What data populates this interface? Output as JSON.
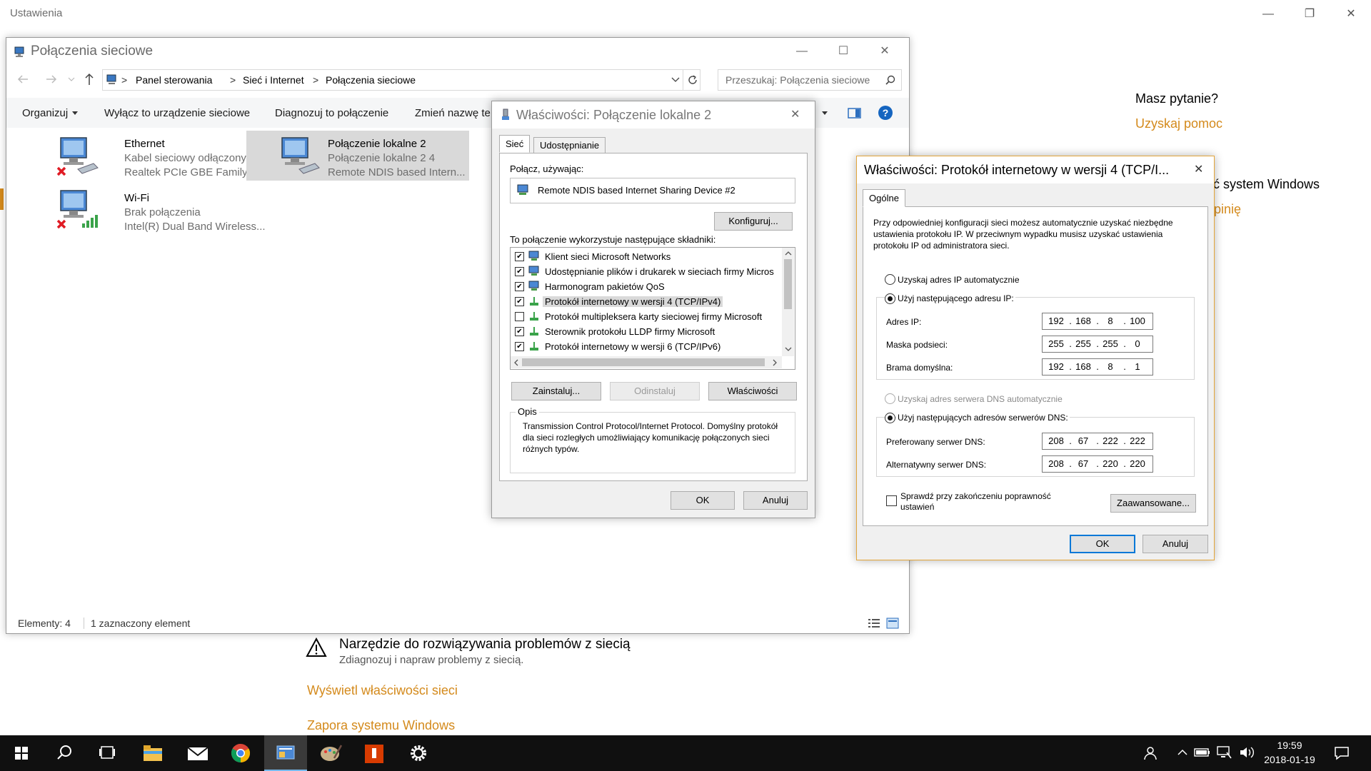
{
  "settings": {
    "title": "Ustawienia",
    "help_question": "Masz pytanie?",
    "help_link": "Uzyskaj pomoc",
    "improve_text": "yć system Windows",
    "feedback_link": "opinię",
    "troubleshoot_title": "Narzędzie do rozwiązywania problemów z siecią",
    "troubleshoot_sub": "Zdiagnozuj i napraw problemy z siecią.",
    "view_props_link": "Wyświetl właściwości sieci",
    "firewall_link": "Zapora systemu Windows",
    "window_controls": {
      "minimize": "—",
      "maximize": "❐",
      "close": "✕"
    }
  },
  "net_window": {
    "title": "Połączenia sieciowe",
    "controls": {
      "minimize": "—",
      "maximize": "☐",
      "close": "✕"
    },
    "breadcrumb": [
      "Panel sterowania",
      "Sieć i Internet",
      "Połączenia sieciowe"
    ],
    "breadcrumb_sep": ">",
    "search_placeholder": "Przeszukaj: Połączenia sieciowe",
    "toolbar": {
      "organize": "Organizuj",
      "disable": "Wyłącz to urządzenie sieciowe",
      "diagnose": "Diagnozuj to połączenie",
      "rename": "Zmień nazwę te"
    },
    "connections": [
      {
        "name": "Ethernet",
        "status": "Kabel sieciowy odłączony",
        "device": "Realtek PCIe GBE Family Co..."
      },
      {
        "name": "Połączenie lokalne 2",
        "status": "Połączenie lokalne 2  4",
        "device": "Remote NDIS based Intern..."
      },
      {
        "name": "Wi-Fi",
        "status": "Brak połączenia",
        "device": "Intel(R) Dual Band Wireless..."
      }
    ],
    "status": {
      "count": "Elementy: 4",
      "selected": "1 zaznaczony element"
    }
  },
  "local_props": {
    "title": "Właściwości: Połączenie lokalne 2",
    "close": "✕",
    "tabs": [
      "Sieć",
      "Udostępnianie"
    ],
    "connect_using_label": "Połącz, używając:",
    "device": "Remote NDIS based Internet Sharing Device #2",
    "configure_btn": "Konfiguruj...",
    "components_label": "To połączenie wykorzystuje następujące składniki:",
    "components": [
      {
        "label": "Klient sieci Microsoft Networks",
        "checked": true
      },
      {
        "label": "Udostępnianie plików i drukarek w sieciach firmy Micros",
        "checked": true
      },
      {
        "label": "Harmonogram pakietów QoS",
        "checked": true
      },
      {
        "label": "Protokół internetowy w wersji 4 (TCP/IPv4)",
        "checked": true
      },
      {
        "label": "Protokół multipleksera karty sieciowej firmy Microsoft",
        "checked": false
      },
      {
        "label": "Sterownik protokołu LLDP firmy Microsoft",
        "checked": true
      },
      {
        "label": "Protokół internetowy w wersji 6 (TCP/IPv6)",
        "checked": true
      }
    ],
    "install_btn": "Zainstaluj...",
    "uninstall_btn": "Odinstaluj",
    "properties_btn": "Właściwości",
    "description_title": "Opis",
    "description": "Transmission Control Protocol/Internet Protocol. Domyślny protokół dla sieci rozległych umożliwiający komunikację połączonych sieci różnych typów.",
    "ok_btn": "OK",
    "cancel_btn": "Anuluj",
    "check_mark": "✔"
  },
  "ipv4": {
    "title": "Właściwości: Protokół internetowy w wersji 4 (TCP/I...",
    "close": "✕",
    "tab": "Ogólne",
    "intro": "Przy odpowiedniej konfiguracji sieci możesz automatycznie uzyskać niezbędne ustawienia protokołu IP. W przeciwnym wypadku musisz uzyskać ustawienia protokołu IP od administratora sieci.",
    "auto_ip": "Uzyskaj adres IP automatycznie",
    "manual_ip": "Użyj następującego adresu IP:",
    "ip_label": "Adres IP:",
    "mask_label": "Maska podsieci:",
    "gateway_label": "Brama domyślna:",
    "ip": [
      "192",
      "168",
      "8",
      "100"
    ],
    "mask": [
      "255",
      "255",
      "255",
      "0"
    ],
    "gateway": [
      "192",
      "168",
      "8",
      "1"
    ],
    "auto_dns": "Uzyskaj adres serwera DNS automatycznie",
    "manual_dns": "Użyj następujących adresów serwerów DNS:",
    "pref_dns_label": "Preferowany serwer DNS:",
    "alt_dns_label": "Alternatywny serwer DNS:",
    "pref_dns": [
      "208",
      "67",
      "222",
      "222"
    ],
    "alt_dns": [
      "208",
      "67",
      "220",
      "220"
    ],
    "validate_label": "Sprawdź przy zakończeniu poprawność ustawień",
    "advanced_btn": "Zaawansowane...",
    "ok_btn": "OK",
    "cancel_btn": "Anuluj",
    "dot": "."
  },
  "taskbar": {
    "time": "19:59",
    "date": "2018-01-19"
  },
  "colors": {
    "accent": "#d48a1c",
    "selection": "#d9d9d9",
    "focus": "#0078d7"
  }
}
